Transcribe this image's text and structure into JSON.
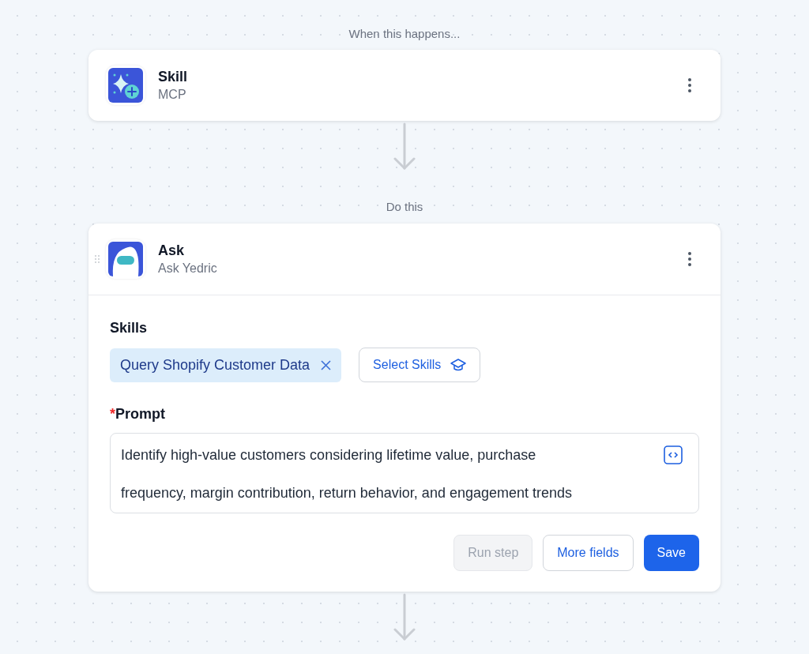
{
  "trigger_label": "When this happens...",
  "trigger": {
    "title": "Skill",
    "subtitle": "MCP"
  },
  "action_label": "Do this",
  "action": {
    "title": "Ask",
    "subtitle": "Ask Yedric",
    "skills_label": "Skills",
    "skills": [
      {
        "label": "Query Shopify Customer Data"
      }
    ],
    "select_button": "Select Skills",
    "prompt": {
      "required_mark": "*",
      "label": "Prompt",
      "value": "Identify high-value customers considering lifetime value, purchase frequency, margin contribution, return behavior, and engagement trends"
    },
    "buttons": [
      {
        "label": "Run step",
        "kind": "secondary",
        "disabled": true
      },
      {
        "label": "More fields",
        "kind": "secondary",
        "disabled": false
      },
      {
        "label": "Save",
        "kind": "primary",
        "disabled": false
      }
    ]
  }
}
